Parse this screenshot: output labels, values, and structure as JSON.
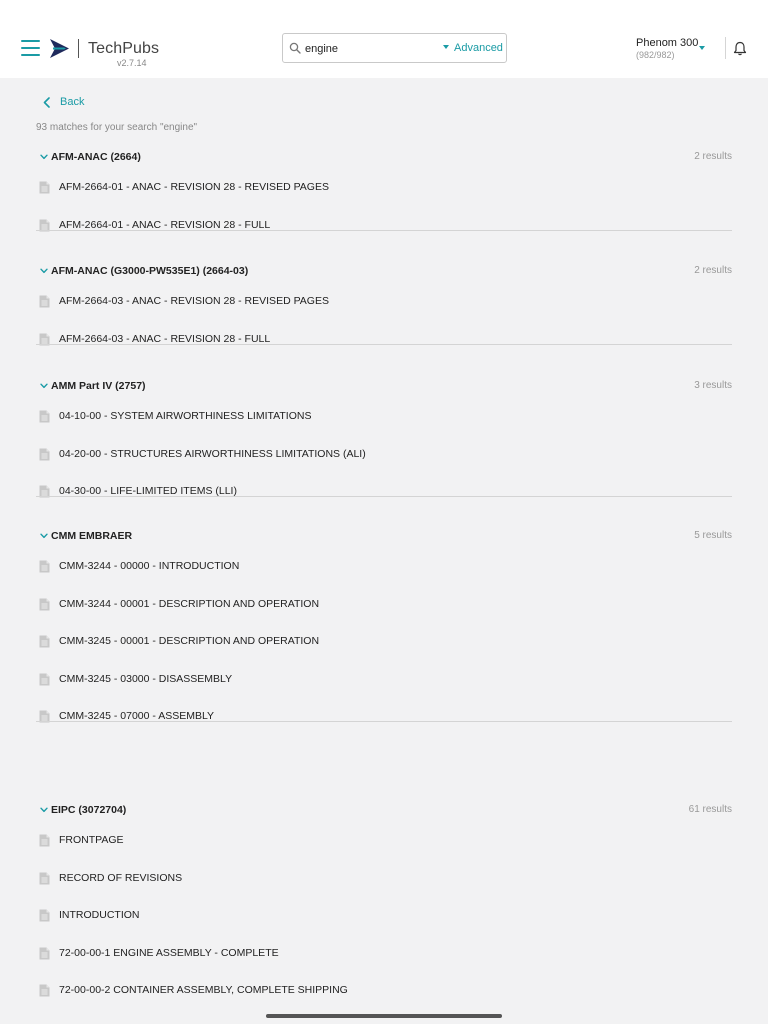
{
  "header": {
    "app_name": "TechPubs",
    "version": "v2.7.14",
    "search": {
      "value": "engine",
      "advanced_label": "Advanced"
    },
    "aircraft": {
      "name": "Phenom 300",
      "count": "(982/982)"
    },
    "icons": [
      "menu-icon",
      "logo-mark-icon",
      "search-icon",
      "dropdown-caret-icon",
      "bell-icon"
    ]
  },
  "back_label": "Back",
  "match_info": "93 matches for your search \"engine\"",
  "groups": [
    {
      "title": "AFM-ANAC (2664)",
      "count": "2 results",
      "items": [
        "AFM-2664-01 - ANAC - REVISION 28 - REVISED PAGES",
        "AFM-2664-01 - ANAC - REVISION 28 - FULL"
      ]
    },
    {
      "title": "AFM-ANAC (G3000-PW535E1) (2664-03)",
      "count": "2 results",
      "items": [
        "AFM-2664-03 - ANAC - REVISION 28 - REVISED PAGES",
        "AFM-2664-03 - ANAC - REVISION 28 - FULL"
      ]
    },
    {
      "title": "AMM Part IV (2757)",
      "count": "3 results",
      "items": [
        "04-10-00 - SYSTEM AIRWORTHINESS LIMITATIONS",
        "04-20-00 - STRUCTURES AIRWORTHINESS LIMITATIONS (ALI)",
        "04-30-00 - LIFE-LIMITED ITEMS (LLI)"
      ]
    },
    {
      "title": "CMM EMBRAER",
      "count": "5 results",
      "items": [
        "CMM-3244 - 00000 - INTRODUCTION",
        "CMM-3244 - 00001 - DESCRIPTION AND OPERATION",
        "CMM-3245 - 00001 - DESCRIPTION AND OPERATION",
        "CMM-3245 - 03000 - DISASSEMBLY",
        "CMM-3245 - 07000 - ASSEMBLY"
      ]
    },
    {
      "title": "EIPC (3072704)",
      "count": "61 results",
      "items": [
        "FRONTPAGE",
        "RECORD OF REVISIONS",
        "INTRODUCTION",
        "72-00-00-1 ENGINE ASSEMBLY - COMPLETE",
        "72-00-00-2 CONTAINER ASSEMBLY, COMPLETE SHIPPING"
      ]
    }
  ],
  "colors": {
    "accent": "#1a9ba5",
    "background": "#f2f2f3",
    "header": "#ffffff"
  }
}
